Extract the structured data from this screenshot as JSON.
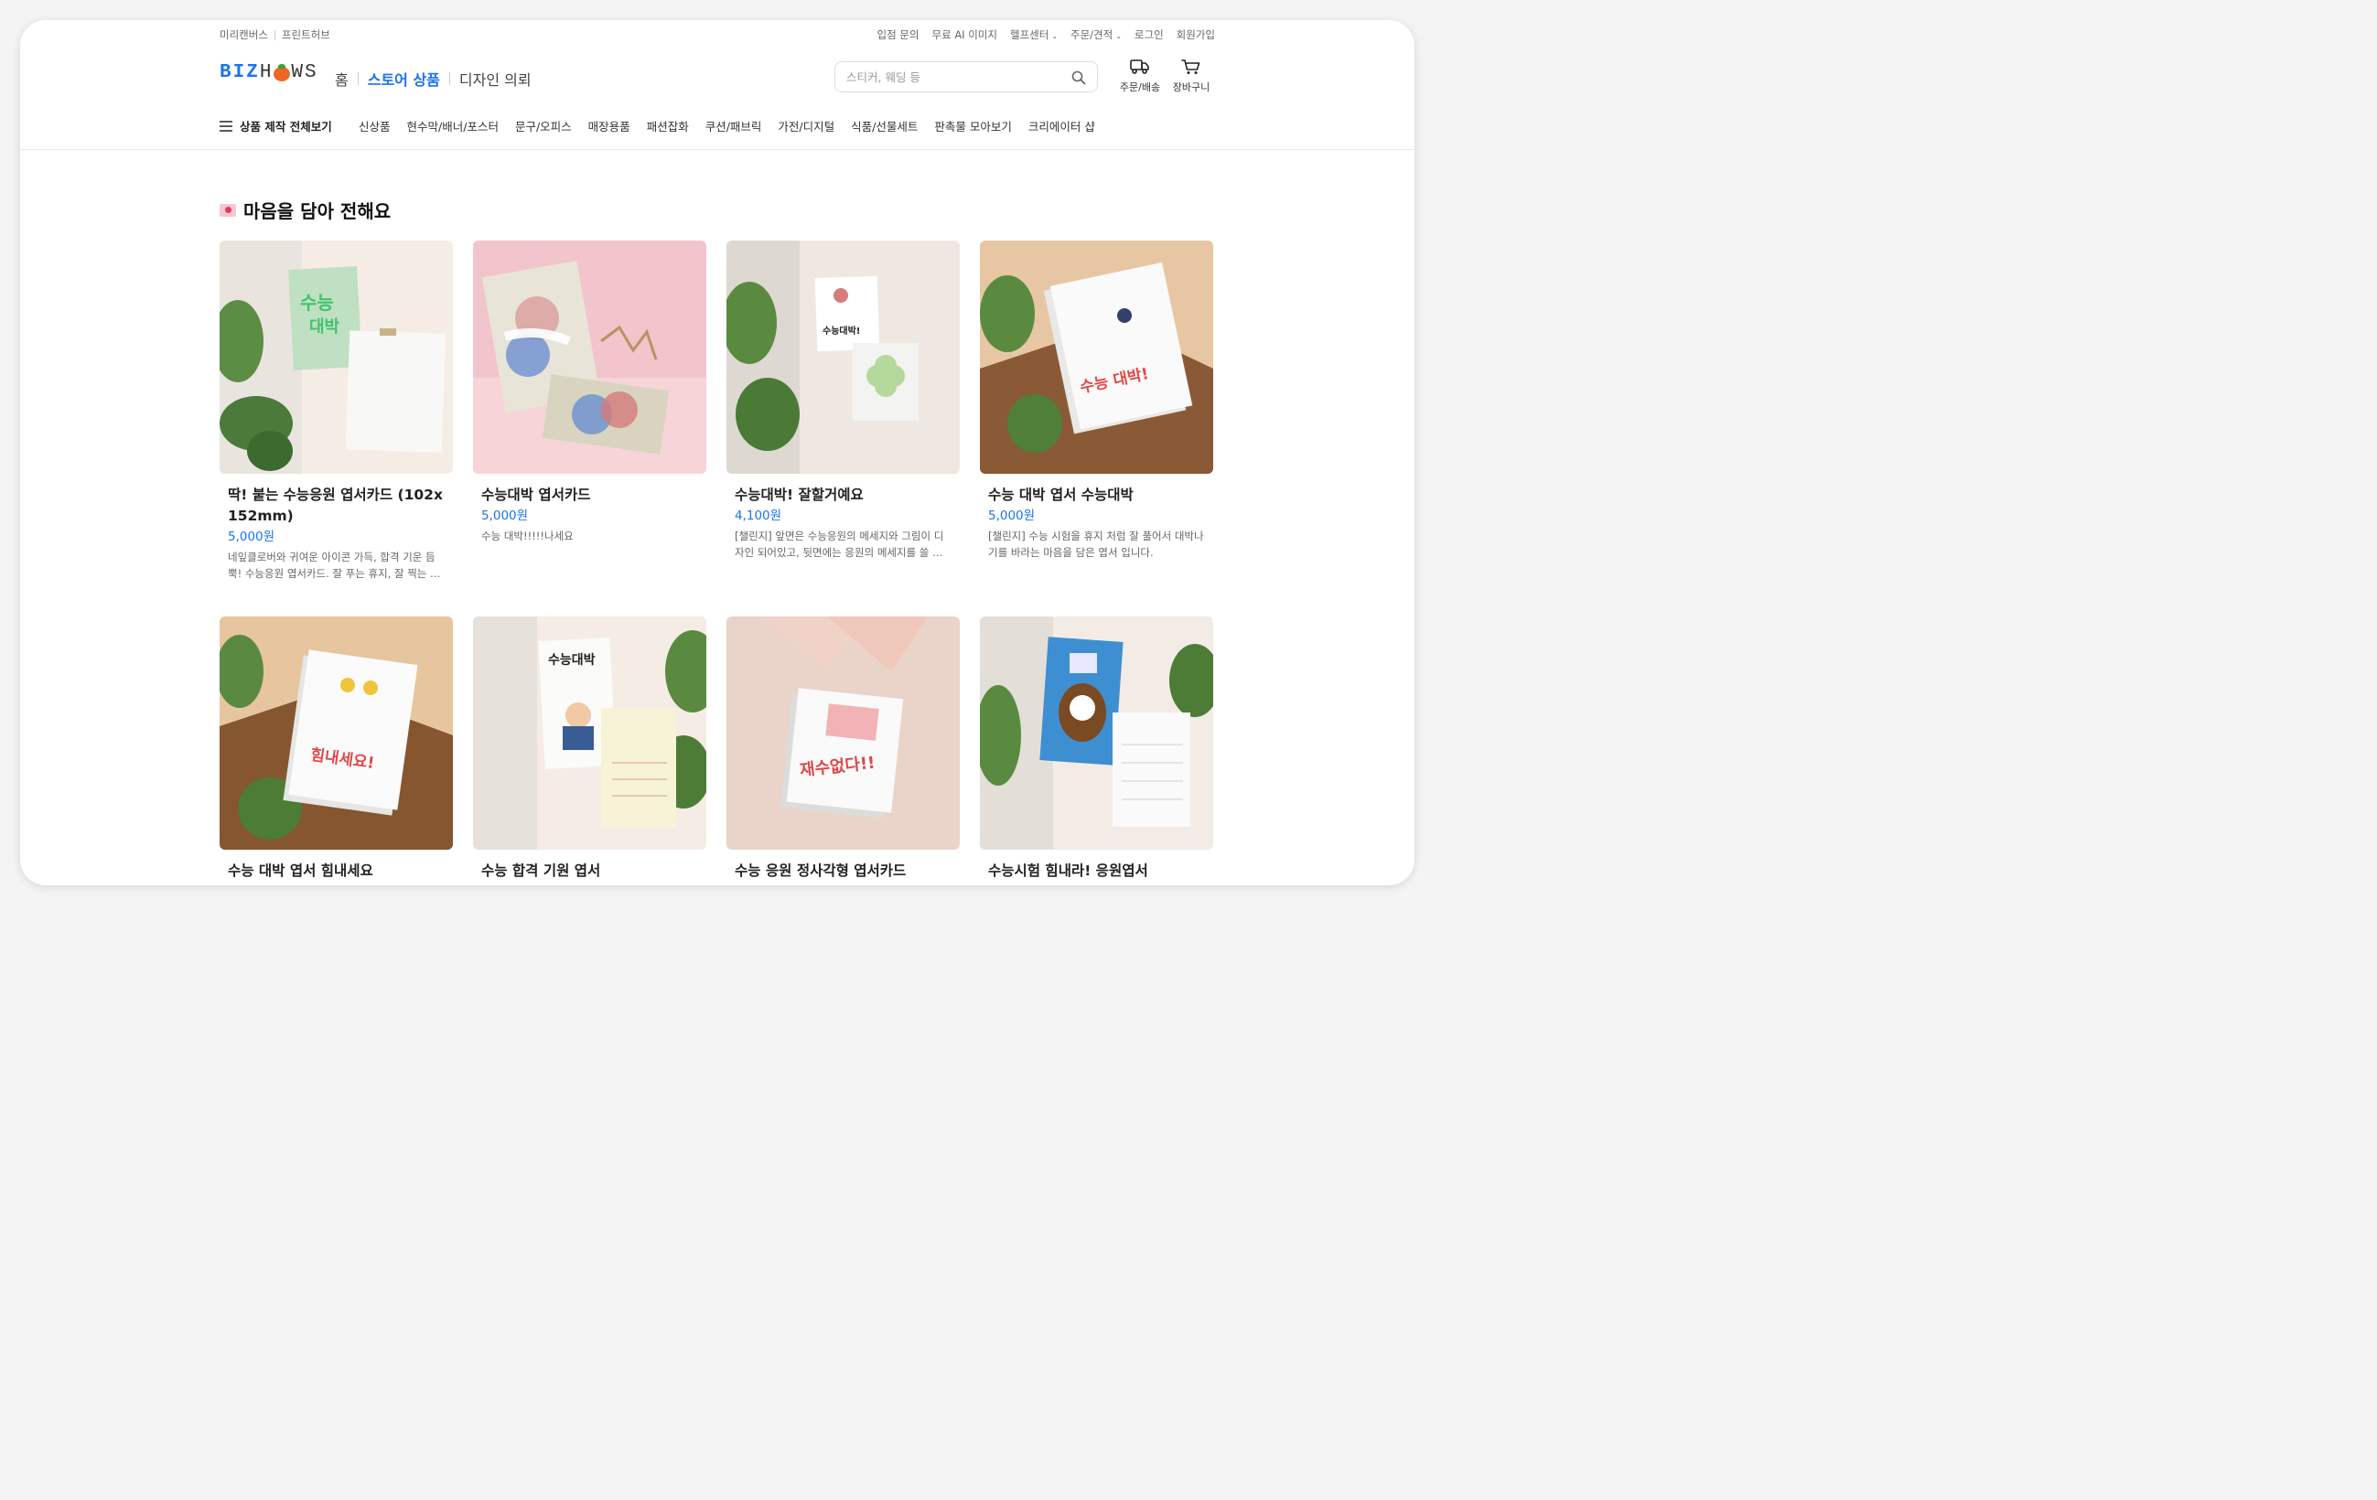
{
  "utility": {
    "left": [
      "미리캔버스",
      "프린트허브"
    ],
    "right": [
      {
        "label": "입점 문의",
        "caret": false
      },
      {
        "label": "무료 AI 이미지",
        "caret": false
      },
      {
        "label": "헬프센터",
        "caret": true
      },
      {
        "label": "주문/견적",
        "caret": true
      },
      {
        "label": "로그인",
        "caret": false
      },
      {
        "label": "회원가입",
        "caret": false
      }
    ]
  },
  "header": {
    "logo": {
      "part1": "BIZ",
      "part2": "H",
      "part3": "WS"
    },
    "gnb": [
      "홈",
      "스토어 상품",
      "디자인 의뢰"
    ],
    "search_placeholder": "스티커, 웨딩 등",
    "order_label": "주문/배송",
    "cart_label": "장바구니"
  },
  "catnav": {
    "all_label": "상품 제작 전체보기",
    "items": [
      "신상품",
      "현수막/배너/포스터",
      "문구/오피스",
      "매장용품",
      "패션잡화",
      "쿠션/패브릭",
      "가전/디지털",
      "식품/선물세트",
      "판촉물 모아보기",
      "크리에이터 샵"
    ]
  },
  "section": {
    "title": "마음을 담아 전해요"
  },
  "products": [
    {
      "title": "딱! 붙는 수능응원 엽서카드 (102x152mm)",
      "price": "5,000원",
      "desc": "네잎클로버와 귀여운 아이콘 가득, 합격 기운 듬뿍! 수능응원 엽서카드. 잘 푸는 휴지, 잘 찍는 포크 등 재치 있는 메시지로 응원을 전해요.",
      "image": "green-postcard-with-note"
    },
    {
      "title": "수능대박 엽서카드",
      "price": "5,000원",
      "desc": "수능 대박!!!!!나세요",
      "image": "pink-card-with-ribbon"
    },
    {
      "title": "수능대박! 잘할거예요",
      "price": "4,100원",
      "desc": "[챌린지] 앞면은 수능응원의 메세지와 그림이 디자인 되어있고, 뒷면에는 응원의 메세지를 쓸 수 있어요.",
      "image": "cheer-card-with-clover"
    },
    {
      "title": "수능 대박 엽서 수능대박",
      "price": "5,000원",
      "desc": "[챌린지] 수능 시험을 휴지 처럼 잘 풀어서 대박나기를 바라는 마음을 담은 엽서 입니다.",
      "image": "postcard-stack-daebak"
    },
    {
      "title": "수능 대박 엽서 힘내세요",
      "price": "",
      "desc": "",
      "image": "postcard-stack-cheer"
    },
    {
      "title": "수능 합격 기원 엽서",
      "price": "",
      "desc": "",
      "image": "wish-card-with-letter"
    },
    {
      "title": "수능 응원 정사각형 엽서카드",
      "price": "",
      "desc": "",
      "image": "square-card-stack"
    },
    {
      "title": "수능시험 힘내라! 응원엽서",
      "price": "",
      "desc": "",
      "image": "blue-bottle-card"
    }
  ],
  "colors": {
    "accent": "#1a74e8",
    "text": "#222222",
    "muted": "#666666"
  }
}
